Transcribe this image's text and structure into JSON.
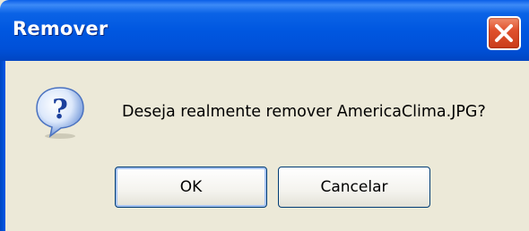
{
  "window": {
    "title": "Remover"
  },
  "dialog": {
    "message": "Deseja realmente remover AmericaClima.JPG?",
    "icon": "question-icon"
  },
  "buttons": {
    "ok_label": "OK",
    "cancel_label": "Cancelar"
  },
  "colors": {
    "titlebar": "#0055e5",
    "close_button": "#e0512d",
    "dialog_background": "#ece9d8"
  }
}
